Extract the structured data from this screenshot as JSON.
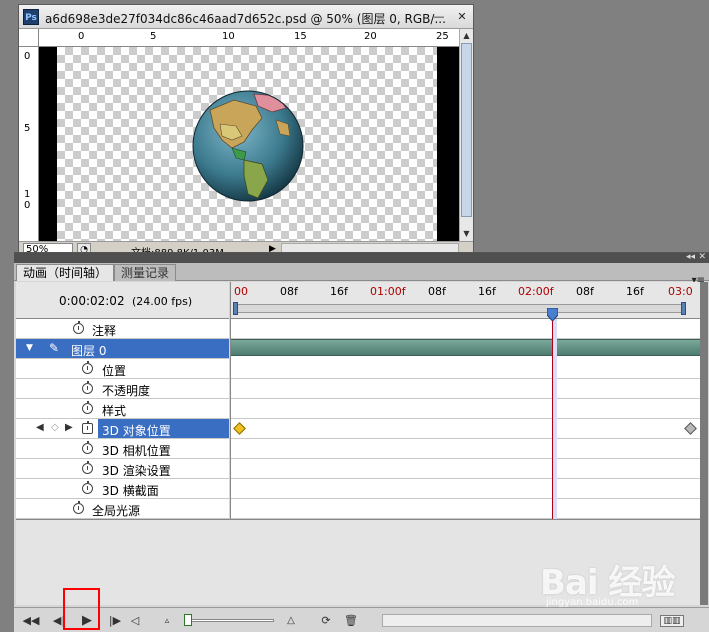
{
  "document": {
    "title": "a6d698e3de27f034dc86c46aad7d652c.psd @ 50% (图层 0, RGB/...",
    "app_icon_text": "Ps",
    "zoom": "50%",
    "doc_info": "文档:889.8K/1.03M",
    "ruler_top_ticks": [
      "0",
      "5",
      "10",
      "15",
      "20",
      "25"
    ],
    "ruler_left_ticks": [
      "0",
      "5",
      "1\n0"
    ]
  },
  "panel": {
    "tabs": [
      "动画（时间轴）",
      "测量记录"
    ],
    "current_time": "0:00:02:02",
    "fps": "(24.00 fps)",
    "timeline_ticks": [
      "00",
      "08f",
      "16f",
      "01:00f",
      "08f",
      "16f",
      "02:00f",
      "08f",
      "16f",
      "03:0"
    ],
    "layers": [
      {
        "label": "注释"
      },
      {
        "label": "图层 0"
      },
      {
        "label": "位置"
      },
      {
        "label": "不透明度"
      },
      {
        "label": "样式"
      },
      {
        "label": "3D 对象位置"
      },
      {
        "label": "3D 相机位置"
      },
      {
        "label": "3D 渲染设置"
      },
      {
        "label": "3D 横截面"
      },
      {
        "label": "全局光源"
      }
    ],
    "playhead_frame": 50,
    "total_frames": 72
  },
  "watermark": {
    "logo": "Bai 经验",
    "url": "jingyan.baidu.com"
  },
  "colors": {
    "selection": "#3a6ec3",
    "layer_bar": "#5e8c80",
    "playhead": "#b0001a",
    "highlight": "#ff0000"
  }
}
